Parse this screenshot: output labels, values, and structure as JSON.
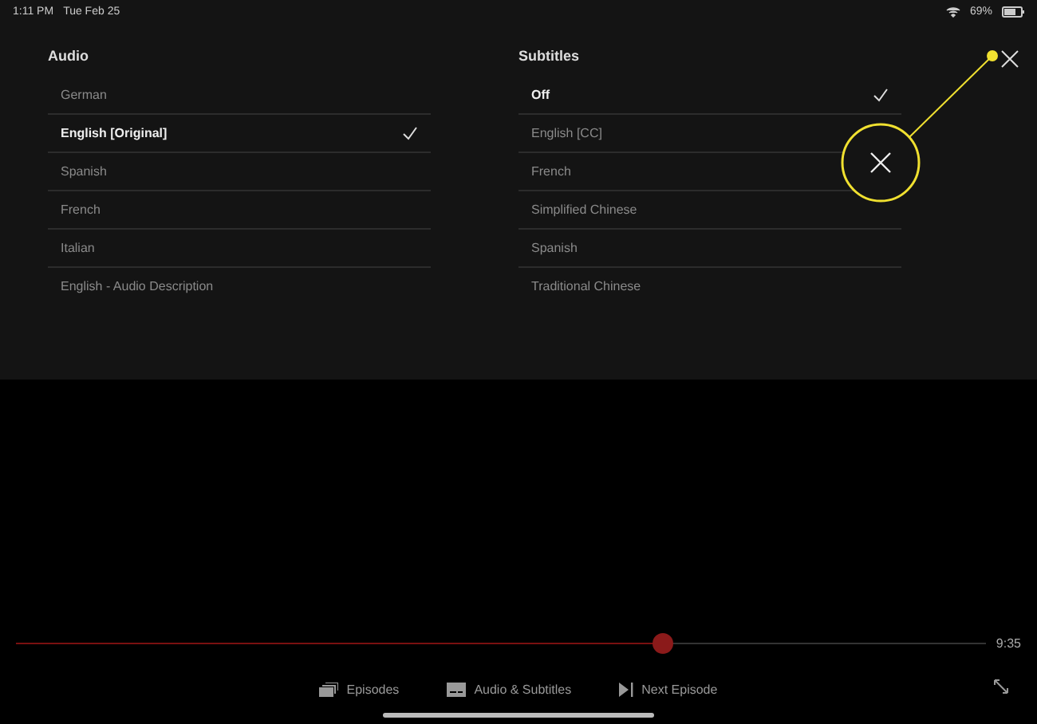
{
  "status_bar": {
    "time": "1:11 PM",
    "date": "Tue Feb 25",
    "battery": "69%"
  },
  "audio": {
    "title": "Audio",
    "items": [
      {
        "label": "German",
        "selected": false
      },
      {
        "label": "English [Original]",
        "selected": true
      },
      {
        "label": "Spanish",
        "selected": false
      },
      {
        "label": "French",
        "selected": false
      },
      {
        "label": "Italian",
        "selected": false
      },
      {
        "label": "English - Audio Description",
        "selected": false
      }
    ]
  },
  "subtitles": {
    "title": "Subtitles",
    "items": [
      {
        "label": "Off",
        "selected": true
      },
      {
        "label": "English [CC]",
        "selected": false
      },
      {
        "label": "French",
        "selected": false
      },
      {
        "label": "Simplified Chinese",
        "selected": false
      },
      {
        "label": "Spanish",
        "selected": false
      },
      {
        "label": "Traditional Chinese",
        "selected": false
      }
    ]
  },
  "player": {
    "progress": {
      "level": 0.665
    },
    "duration": "9:35",
    "controls": [
      {
        "kind": "episodes",
        "label": "Episodes"
      },
      {
        "kind": "subtitles",
        "label": "Audio & Subtitles"
      },
      {
        "kind": "next",
        "label": "Next Episode"
      }
    ]
  }
}
